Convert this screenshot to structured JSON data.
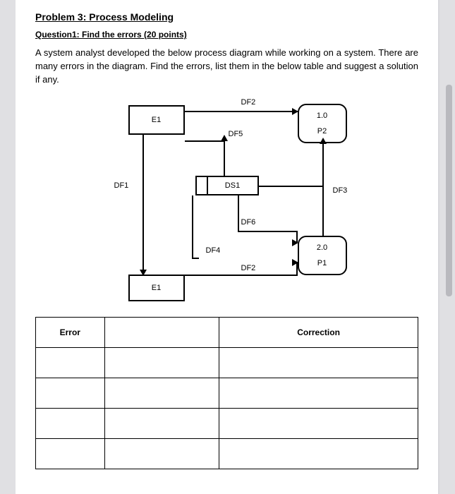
{
  "header": {
    "problem_title": "Problem 3: Process Modeling",
    "question_line": "Question1: Find the errors (20 points)",
    "body": "A system analyst developed the below process diagram while working on a system. There are many errors in the diagram. Find the errors, list them in the below table and suggest a solution if any."
  },
  "diagram": {
    "entities": {
      "e1a": "E1",
      "e1b": "E1"
    },
    "processes": {
      "p2_num": "1.0",
      "p2_name": "P2",
      "p1_num": "2.0",
      "p1_name": "P1"
    },
    "store": {
      "ds1": "DS1"
    },
    "flows": {
      "df1": "DF1",
      "df2a": "DF2",
      "df2b": "DF2",
      "df3": "DF3",
      "df4": "DF4",
      "df5": "DF5",
      "df6": "DF6"
    }
  },
  "table": {
    "head_error": "Error",
    "head_correction": "Correction"
  }
}
